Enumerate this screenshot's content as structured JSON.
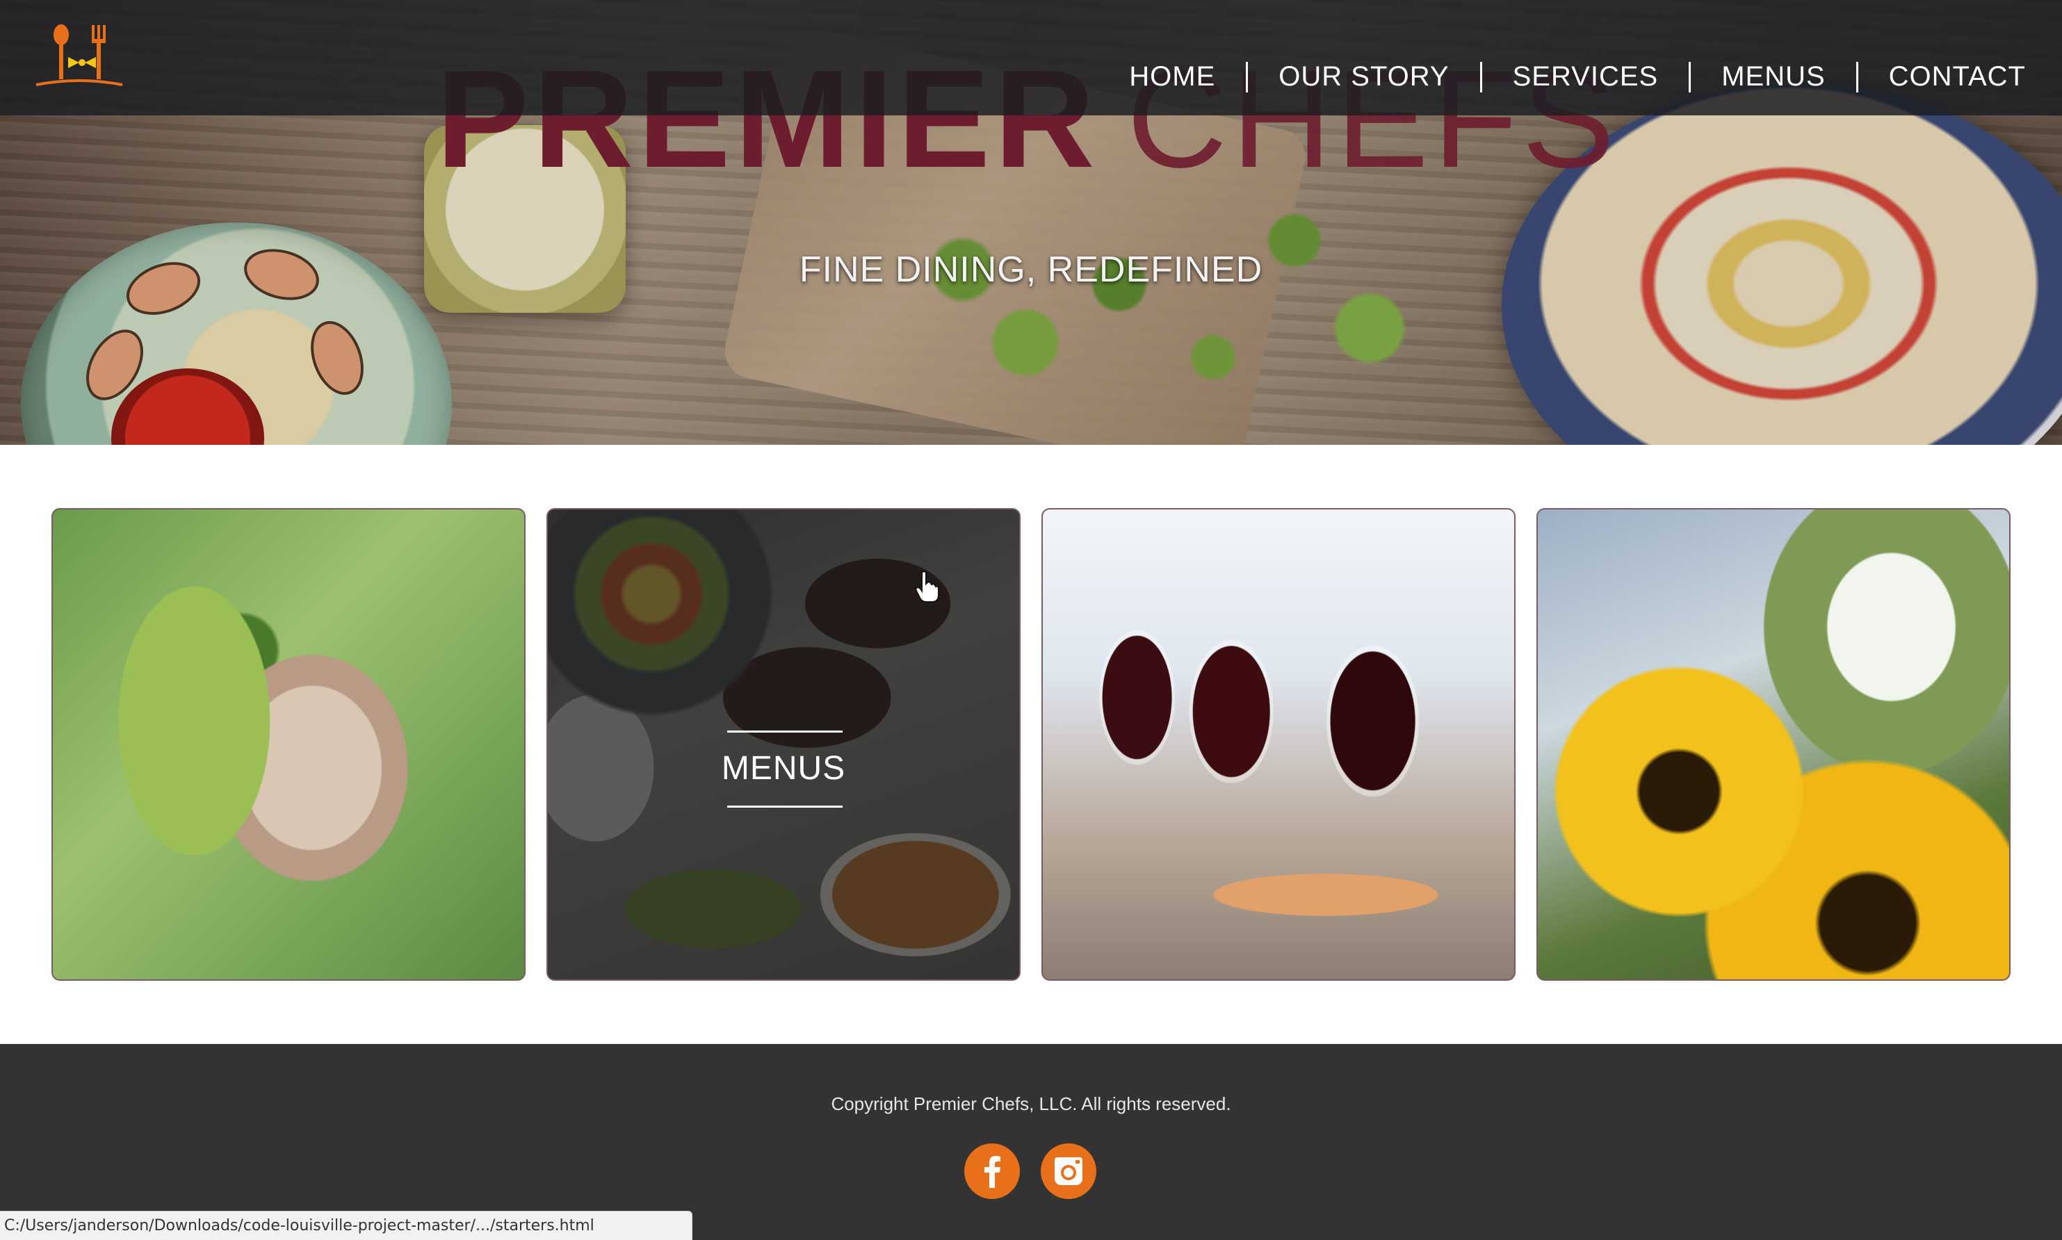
{
  "brand": {
    "title_bold": "PREMIER",
    "title_light": "CHEFS",
    "tagline": "FINE DINING, REDEFINED",
    "logo_icon": "chef-bowtie-fork-spoon-icon",
    "accent_color": "#e8701a",
    "title_color": "#6e1d2e"
  },
  "nav": {
    "items": [
      {
        "label": "HOME"
      },
      {
        "label": "OUR STORY"
      },
      {
        "label": "SERVICES"
      },
      {
        "label": "MENUS"
      },
      {
        "label": "CONTACT"
      }
    ]
  },
  "tiles": [
    {
      "image": "pulled-pork-lettuce-wrap-photo"
    },
    {
      "image": "catering-trays-photo",
      "label": "MENUS"
    },
    {
      "image": "wine-glasses-appetizers-photo"
    },
    {
      "image": "sunflowers-babys-breath-photo"
    }
  ],
  "footer": {
    "copyright": "Copyright Premier Chefs, LLC. All rights reserved.",
    "social": [
      {
        "icon": "facebook-icon"
      },
      {
        "icon": "instagram-icon"
      }
    ]
  },
  "status_bar": {
    "url": "C:/Users/janderson/Downloads/code-louisville-project-master/.../starters.html"
  }
}
